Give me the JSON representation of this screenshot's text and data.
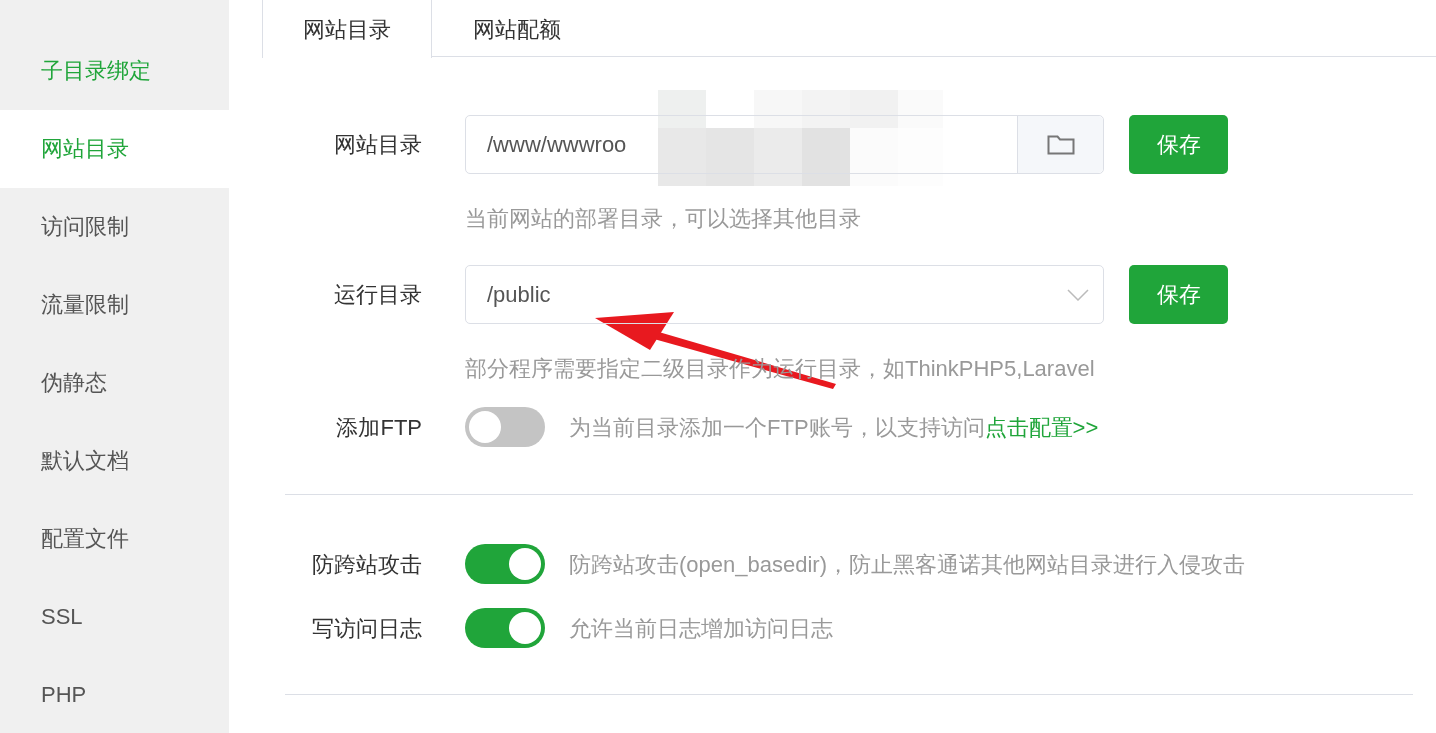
{
  "sidebar": {
    "items": [
      {
        "label": "子目录绑定",
        "selected": false,
        "hovered": true
      },
      {
        "label": "网站目录",
        "selected": true,
        "hovered": false
      },
      {
        "label": "访问限制",
        "selected": false,
        "hovered": false
      },
      {
        "label": "流量限制",
        "selected": false,
        "hovered": false
      },
      {
        "label": "伪静态",
        "selected": false,
        "hovered": false
      },
      {
        "label": "默认文档",
        "selected": false,
        "hovered": false
      },
      {
        "label": "配置文件",
        "selected": false,
        "hovered": false
      },
      {
        "label": "SSL",
        "selected": false,
        "hovered": false
      },
      {
        "label": "PHP",
        "selected": false,
        "hovered": false
      }
    ]
  },
  "tabs": [
    {
      "label": "网站目录",
      "selected": true
    },
    {
      "label": "网站配额",
      "selected": false
    }
  ],
  "site_dir": {
    "label": "网站目录",
    "value": "/www/wwwroo",
    "button": "保存",
    "hint": "当前网站的部署目录，可以选择其他目录"
  },
  "run_dir": {
    "label": "运行目录",
    "value": "/public",
    "button": "保存",
    "hint": "部分程序需要指定二级目录作为运行目录，如ThinkPHP5,Laravel"
  },
  "ftp": {
    "label": "添加FTP",
    "on": false,
    "description": "为当前目录添加一个FTP账号，以支持访问",
    "link": "点击配置>>"
  },
  "switches": [
    {
      "label": "防跨站攻击",
      "on": true,
      "description": "防跨站攻击(open_basedir)，防止黑客通诺其他网站目录进行入侵攻击"
    },
    {
      "label": "写访问日志",
      "on": true,
      "description": "允许当前日志增加访问日志"
    }
  ]
}
